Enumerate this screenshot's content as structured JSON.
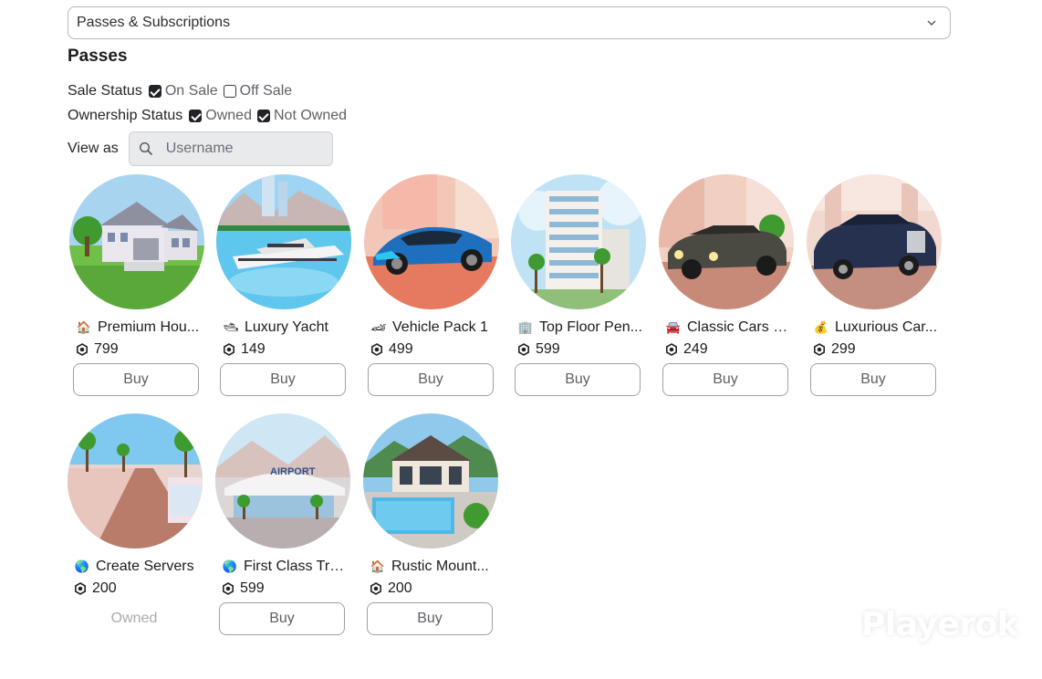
{
  "dropdown": {
    "label": "Passes & Subscriptions"
  },
  "heading": "Passes",
  "filters": {
    "sale_status": {
      "label": "Sale Status",
      "options": [
        {
          "label": "On Sale",
          "checked": true
        },
        {
          "label": "Off Sale",
          "checked": false
        }
      ]
    },
    "ownership_status": {
      "label": "Ownership Status",
      "options": [
        {
          "label": "Owned",
          "checked": true
        },
        {
          "label": "Not Owned",
          "checked": true
        }
      ]
    }
  },
  "view_as": {
    "label": "View as",
    "placeholder": "Username"
  },
  "passes": [
    {
      "emoji": "🏠",
      "name": "Premium Hou...",
      "price": "799",
      "action": "Buy",
      "owned": false
    },
    {
      "emoji": "🛥",
      "name": "Luxury Yacht",
      "price": "149",
      "action": "Buy",
      "owned": false
    },
    {
      "emoji": "🏎",
      "name": "Vehicle Pack 1",
      "price": "499",
      "action": "Buy",
      "owned": false
    },
    {
      "emoji": "🏢",
      "name": "Top Floor Pen...",
      "price": "599",
      "action": "Buy",
      "owned": false
    },
    {
      "emoji": "🚘",
      "name": "Classic Cars P...",
      "price": "249",
      "action": "Buy",
      "owned": false
    },
    {
      "emoji": "💰",
      "name": "Luxurious Car...",
      "price": "299",
      "action": "Buy",
      "owned": false
    },
    {
      "emoji": "🌎",
      "name": "Create Servers",
      "price": "200",
      "action": "Owned",
      "owned": true
    },
    {
      "emoji": "🌎",
      "name": "First Class Tra...",
      "price": "599",
      "action": "Buy",
      "owned": false
    },
    {
      "emoji": "🏠",
      "name": "Rustic Mount...",
      "price": "200",
      "action": "Buy",
      "owned": false
    }
  ],
  "thumbnail_signs": {
    "airport": "AIRPORT"
  },
  "watermark": "Playerok"
}
